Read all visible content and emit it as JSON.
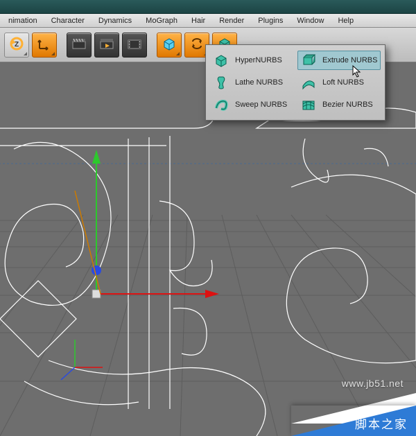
{
  "menubar": {
    "items": [
      "nimation",
      "Character",
      "Dynamics",
      "MoGraph",
      "Hair",
      "Render",
      "Plugins",
      "Window",
      "Help"
    ]
  },
  "toolbar": {
    "buttons": [
      {
        "name": "undo-button",
        "desc": "undo"
      },
      {
        "name": "axis-move-button",
        "desc": "axis-arrow"
      },
      {
        "name": "clapper1-button",
        "desc": "clapper"
      },
      {
        "name": "clapper2-button",
        "desc": "clapper-play"
      },
      {
        "name": "clapper3-button",
        "desc": "clapper-film"
      },
      {
        "name": "cube-button",
        "desc": "cube"
      },
      {
        "name": "swap-button",
        "desc": "swap"
      },
      {
        "name": "nurbs-button",
        "desc": "nurbs-cube"
      },
      {
        "name": "extra1-button",
        "desc": "teal1"
      },
      {
        "name": "extra2-button",
        "desc": "teal2"
      },
      {
        "name": "extra3-button",
        "desc": "teal3"
      },
      {
        "name": "extra4-button",
        "desc": "teal4"
      },
      {
        "name": "extra5-button",
        "desc": "teal5"
      }
    ]
  },
  "dropdown": {
    "items": [
      {
        "name": "hypernurbs",
        "label": "HyperNURBS",
        "icon": "cube-round",
        "hi": false
      },
      {
        "name": "extrudenurbs",
        "label": "Extrude NURBS",
        "icon": "extrude",
        "hi": true
      },
      {
        "name": "lathenurbs",
        "label": "Lathe NURBS",
        "icon": "vase",
        "hi": false
      },
      {
        "name": "loftnurbs",
        "label": "Loft NURBS",
        "icon": "loft",
        "hi": false
      },
      {
        "name": "sweepnurbs",
        "label": "Sweep NURBS",
        "icon": "sweep",
        "hi": false
      },
      {
        "name": "beziernurbs",
        "label": "Bezier NURBS",
        "icon": "bezier",
        "hi": false
      }
    ]
  },
  "watermark": {
    "url": "www.jb51.net",
    "text": "脚本之家"
  },
  "colors": {
    "accent_teal": "#3fc1a8",
    "accent_orange": "#e07800",
    "gizmo_x": "#d33",
    "gizmo_y": "#3c3",
    "gizmo_z": "#36d"
  }
}
